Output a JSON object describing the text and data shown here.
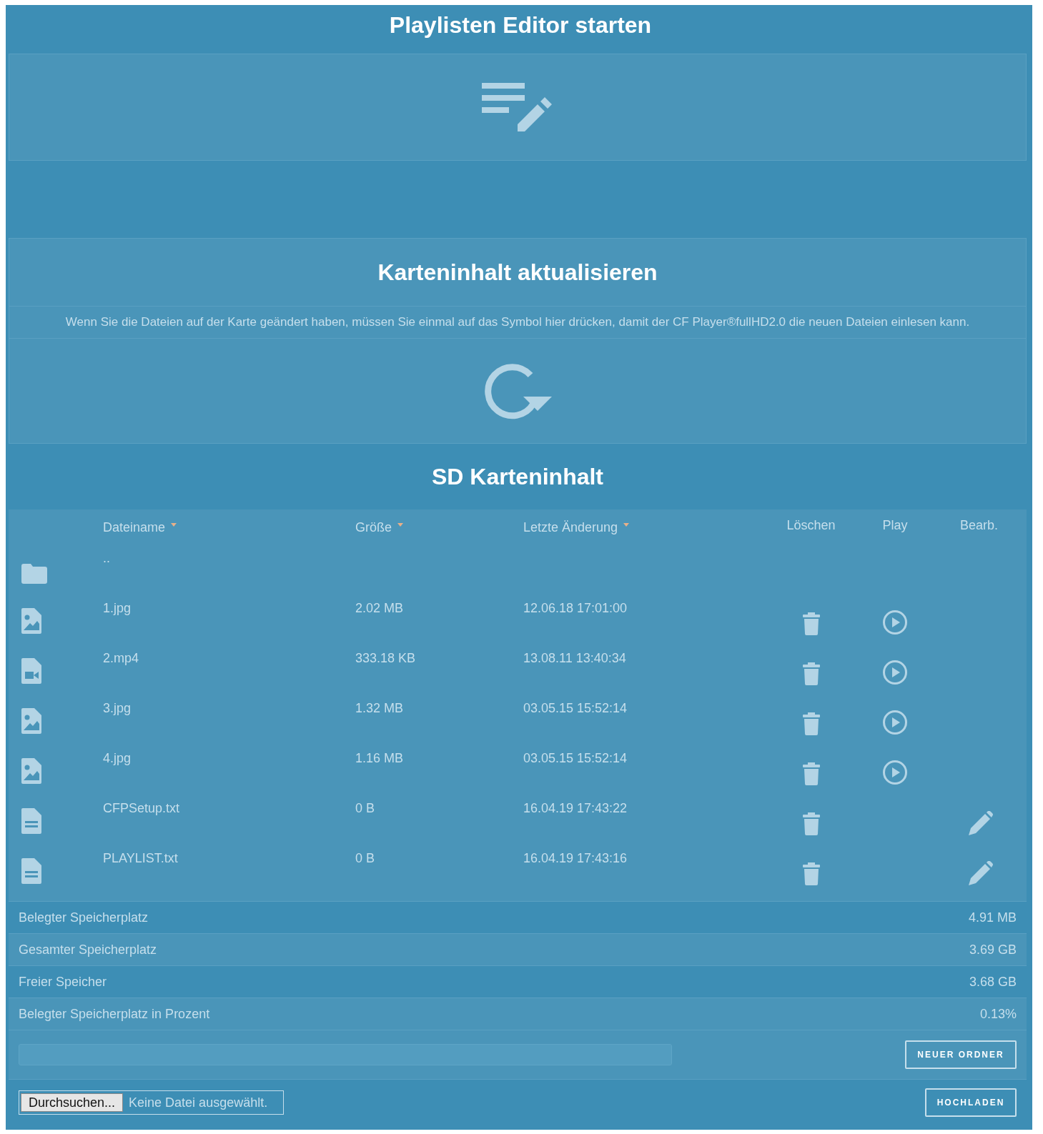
{
  "editor": {
    "title": "Playlisten Editor starten"
  },
  "refresh": {
    "title": "Karteninhalt aktualisieren",
    "description": "Wenn Sie die Dateien auf der Karte geändert haben, müssen Sie einmal auf das Symbol hier drücken, damit der CF Player®fullHD2.0 die neuen Dateien einlesen kann."
  },
  "files": {
    "title": "SD Karteninhalt",
    "columns": [
      {
        "label": "Dateiname",
        "sortable": true
      },
      {
        "label": "Größe",
        "sortable": true
      },
      {
        "label": "Letzte Änderung",
        "sortable": true
      },
      {
        "label": "Löschen",
        "sortable": false
      },
      {
        "label": "Play",
        "sortable": false
      },
      {
        "label": "Bearb.",
        "sortable": false
      }
    ],
    "rows": [
      {
        "kind": "folder",
        "name": "..",
        "deletable": false,
        "playable": false,
        "editable": false
      },
      {
        "kind": "image",
        "name": "1.jpg",
        "size": "2.02 MB",
        "modified": "12.06.18 17:01:00",
        "deletable": true,
        "playable": true,
        "editable": false
      },
      {
        "kind": "video",
        "name": "2.mp4",
        "size": "333.18 KB",
        "modified": "13.08.11 13:40:34",
        "deletable": true,
        "playable": true,
        "editable": false
      },
      {
        "kind": "image",
        "name": "3.jpg",
        "size": "1.32 MB",
        "modified": "03.05.15 15:52:14",
        "deletable": true,
        "playable": true,
        "editable": false
      },
      {
        "kind": "image",
        "name": "4.jpg",
        "size": "1.16 MB",
        "modified": "03.05.15 15:52:14",
        "deletable": true,
        "playable": true,
        "editable": false
      },
      {
        "kind": "text",
        "name": "CFPSetup.txt",
        "size": "0 B",
        "modified": "16.04.19 17:43:22",
        "deletable": true,
        "playable": false,
        "editable": true
      },
      {
        "kind": "text",
        "name": "PLAYLIST.txt",
        "size": "0 B",
        "modified": "16.04.19 17:43:16",
        "deletable": true,
        "playable": false,
        "editable": true
      }
    ]
  },
  "storage": [
    {
      "label": "Belegter Speicherplatz",
      "value": "4.91 MB"
    },
    {
      "label": "Gesamter Speicherplatz",
      "value": "3.69 GB"
    },
    {
      "label": "Freier Speicher",
      "value": "3.68 GB"
    },
    {
      "label": "Belegter Speicherplatz in Prozent",
      "value": "0.13%"
    }
  ],
  "new_folder": {
    "button": "NEUER ORDNER"
  },
  "upload": {
    "browse_button": "Durchsuchen...",
    "file_status": "Keine Datei ausgewählt.",
    "button": "HOCHLADEN"
  }
}
